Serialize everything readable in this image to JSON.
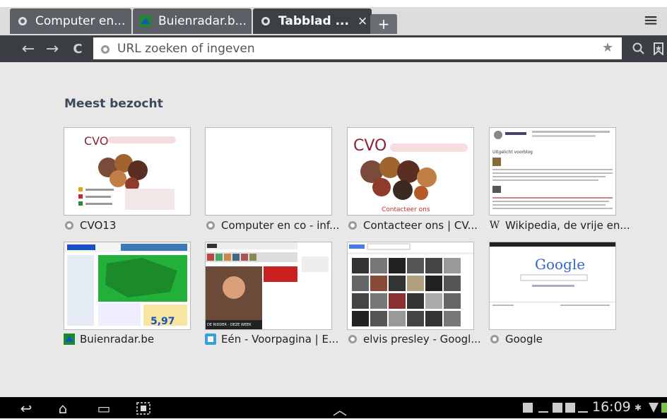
{
  "tabs": [
    {
      "title": "Computer en...",
      "active": false,
      "icon": "globe-icon"
    },
    {
      "title": "Buienradar.b...",
      "active": false,
      "icon": "buienradar-icon"
    },
    {
      "title": "Tabblad ...",
      "active": true,
      "icon": "globe-icon",
      "close": "×"
    }
  ],
  "new_tab_label": "+",
  "toolbar": {
    "back_icon": "←",
    "forward_icon": "→",
    "reload_icon": "C",
    "url_placeholder": "URL zoeken of ingeven",
    "bookmark_icon": "★",
    "search_icon": "🔍",
    "bookmarks_icon": "bookmark-icon",
    "menu_icon": "≡"
  },
  "main": {
    "heading": "Meest bezocht",
    "sites": [
      {
        "label": "CVO13",
        "icon": "globe-icon"
      },
      {
        "label": "Computer en co - inf...",
        "icon": "globe-icon"
      },
      {
        "label": "Contacteer ons | CV...",
        "icon": "globe-icon"
      },
      {
        "label": "Wikipedia, de vrije en...",
        "icon": "wikipedia-icon"
      },
      {
        "label": "Buienradar.be",
        "icon": "buienradar-icon"
      },
      {
        "label": "Eén - Voorpagina | E...",
        "icon": "een-icon"
      },
      {
        "label": "elvis presley - Googl...",
        "icon": "globe-icon"
      },
      {
        "label": "Google",
        "icon": "globe-icon"
      }
    ],
    "thumb_texts": {
      "cvo_logo": "CVO",
      "contacteer": "Contacteer ons",
      "google_logo": "Google",
      "buienradar_value": "5,97",
      "een_banner": "DE RIDDER - DEZE WEEK",
      "wiki_heading": "Uitgelicht voorblog"
    }
  },
  "system": {
    "back_icon": "↩",
    "home_icon": "⌂",
    "recent_icon": "▭",
    "screenshot_icon": "screenshot-icon",
    "up_icon": "︿",
    "time": "16:09"
  },
  "colors": {
    "tab_inactive": "#5c6066",
    "tab_active": "#3c3f44",
    "toolbar": "#3b3e43",
    "heading": "#3a4a5c"
  }
}
